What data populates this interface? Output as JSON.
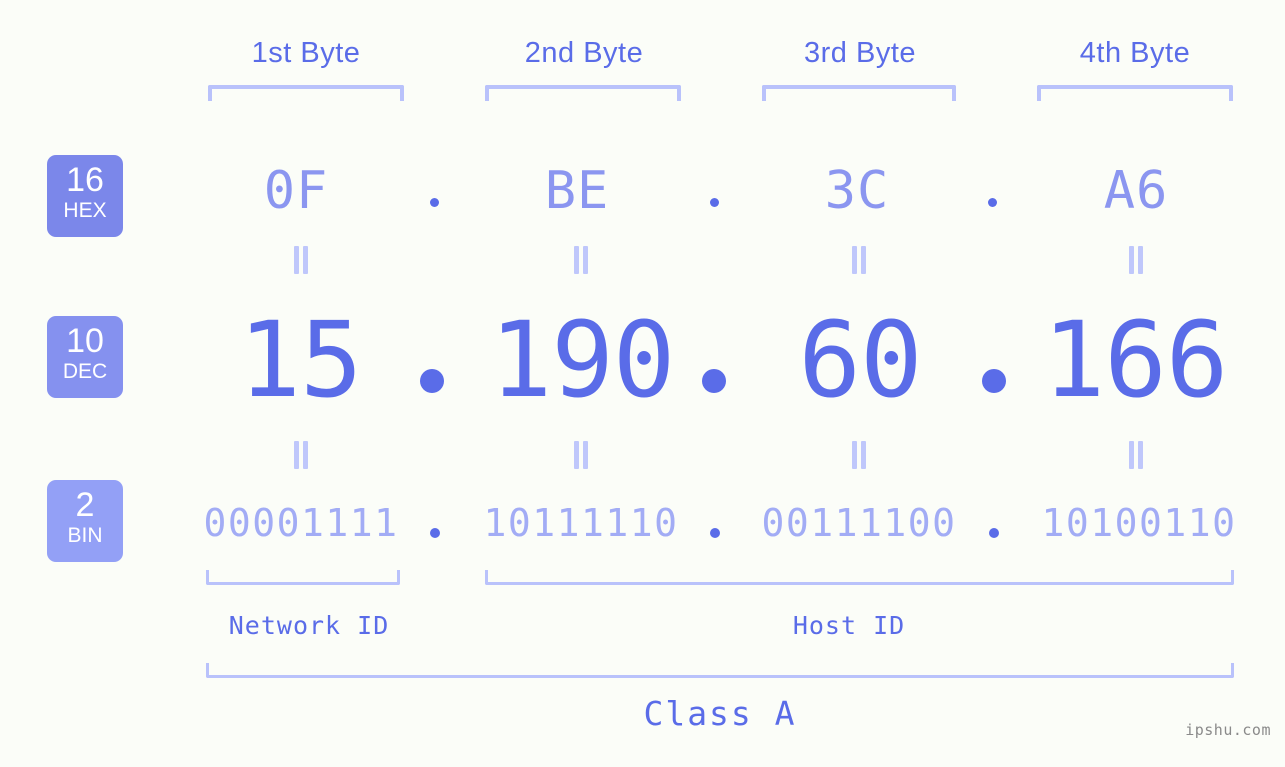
{
  "colors": {
    "background": "#fbfdf8",
    "accent": "#5a6ce8",
    "bracket": "#b9c2fb",
    "hex_text": "#8b96f0",
    "bin_text": "#a2acf5",
    "badge_hex": "#7b87ea",
    "badge_dec": "#8591ef",
    "badge_bin": "#93a0f6",
    "watermark": "#8a8a8a"
  },
  "byte_headers": [
    {
      "label": "1st Byte"
    },
    {
      "label": "2nd Byte"
    },
    {
      "label": "3rd Byte"
    },
    {
      "label": "4th Byte"
    }
  ],
  "bases": [
    {
      "radix": "16",
      "name": "HEX"
    },
    {
      "radix": "10",
      "name": "DEC"
    },
    {
      "radix": "2",
      "name": "BIN"
    }
  ],
  "rows": {
    "hex": {
      "radix": "16",
      "name": "HEX",
      "octets": [
        "0F",
        "BE",
        "3C",
        "A6"
      ]
    },
    "dec": {
      "radix": "10",
      "name": "DEC",
      "octets": [
        "15",
        "190",
        "60",
        "166"
      ]
    },
    "bin": {
      "radix": "2",
      "name": "BIN",
      "octets": [
        "00001111",
        "10111110",
        "00111100",
        "10100110"
      ]
    }
  },
  "separators": {
    "hex": [
      ".",
      ".",
      "."
    ],
    "dec": [
      ".",
      ".",
      "."
    ],
    "bin": [
      ".",
      ".",
      "."
    ]
  },
  "equals_marker": "=",
  "segments": {
    "network_id": "Network ID",
    "host_id": "Host ID",
    "class": "Class A"
  },
  "watermark": "ipshu.com"
}
